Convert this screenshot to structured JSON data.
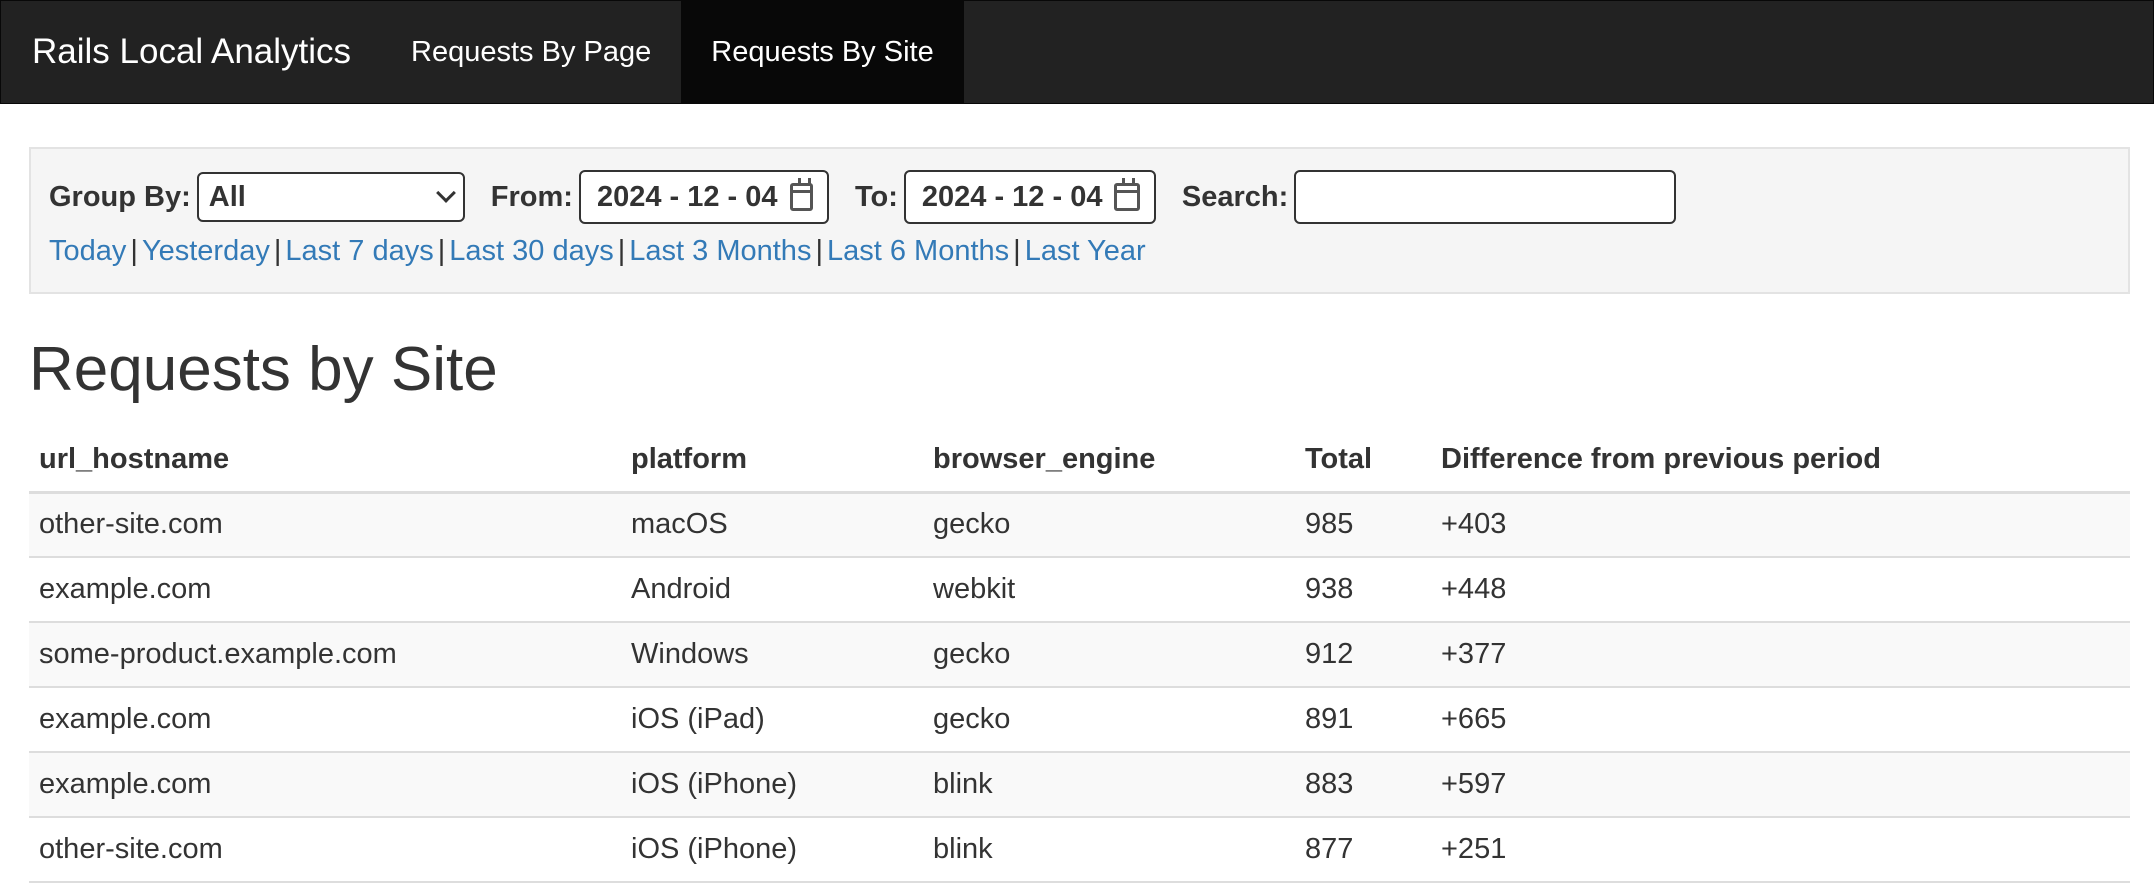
{
  "navbar": {
    "brand": "Rails Local Analytics",
    "links": [
      {
        "label": "Requests By Page",
        "active": false
      },
      {
        "label": "Requests By Site",
        "active": true
      }
    ]
  },
  "filters": {
    "group_by_label": "Group By:",
    "group_by_value": "All",
    "from_label": "From:",
    "from_value": "2024 - 12 - 04",
    "to_label": "To:",
    "to_value": "2024 - 12 - 04",
    "search_label": "Search:",
    "search_value": "",
    "ranges": [
      "Today",
      "Yesterday",
      "Last 7 days",
      "Last 30 days",
      "Last 3 Months",
      "Last 6 Months",
      "Last Year"
    ],
    "separator": "|"
  },
  "page_title": "Requests by Site",
  "table": {
    "headers": [
      "url_hostname",
      "platform",
      "browser_engine",
      "Total",
      "Difference from previous period"
    ],
    "rows": [
      [
        "other-site.com",
        "macOS",
        "gecko",
        "985",
        "+403"
      ],
      [
        "example.com",
        "Android",
        "webkit",
        "938",
        "+448"
      ],
      [
        "some-product.example.com",
        "Windows",
        "gecko",
        "912",
        "+377"
      ],
      [
        "example.com",
        "iOS (iPad)",
        "gecko",
        "891",
        "+665"
      ],
      [
        "example.com",
        "iOS (iPhone)",
        "blink",
        "883",
        "+597"
      ],
      [
        "other-site.com",
        "iOS (iPhone)",
        "blink",
        "877",
        "+251"
      ]
    ]
  },
  "icons": {
    "calendar": "calendar-icon",
    "select_arrow": "chevron-down-icon"
  },
  "colors": {
    "navbar_bg": "#222222",
    "navbar_active_bg": "#080808",
    "link": "#337ab7",
    "panel_bg": "#f5f5f5"
  }
}
